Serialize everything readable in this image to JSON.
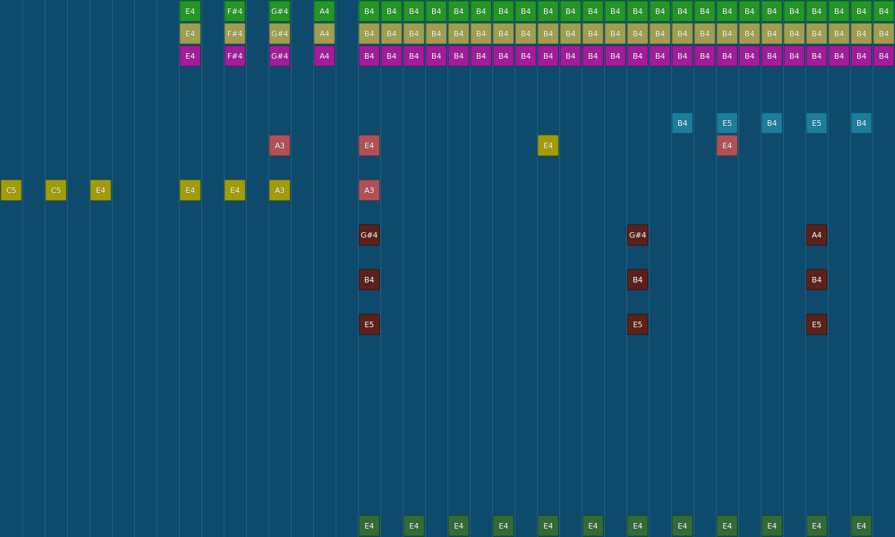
{
  "palette": {
    "green": {
      "bg": "#1f9a1f",
      "border": "#0f6d0f"
    },
    "khaki": {
      "bg": "#a3a34e",
      "border": "#74742d"
    },
    "magenta": {
      "bg": "#a5179e",
      "border": "#730f6e"
    },
    "cyan": {
      "bg": "#177fa0",
      "border": "#0e5b74"
    },
    "rose": {
      "bg": "#b64f55",
      "border": "#87353a"
    },
    "olive": {
      "bg": "#a6a100",
      "border": "#787300"
    },
    "maroon": {
      "bg": "#5a1c14",
      "border": "#3b0f0a"
    },
    "darkgreen": {
      "bg": "#2f6b32",
      "border": "#1c4a1f"
    }
  },
  "notes": [
    {
      "label": "E4",
      "col": 8,
      "row": 0,
      "color": "green"
    },
    {
      "label": "F#4",
      "col": 10,
      "row": 0,
      "color": "green"
    },
    {
      "label": "G#4",
      "col": 12,
      "row": 0,
      "color": "green"
    },
    {
      "label": "A4",
      "col": 14,
      "row": 0,
      "color": "green"
    },
    {
      "label": "B4",
      "col": 16,
      "row": 0,
      "color": "green"
    },
    {
      "label": "B4",
      "col": 17,
      "row": 0,
      "color": "green"
    },
    {
      "label": "B4",
      "col": 18,
      "row": 0,
      "color": "green"
    },
    {
      "label": "B4",
      "col": 19,
      "row": 0,
      "color": "green"
    },
    {
      "label": "B4",
      "col": 20,
      "row": 0,
      "color": "green"
    },
    {
      "label": "B4",
      "col": 21,
      "row": 0,
      "color": "green"
    },
    {
      "label": "B4",
      "col": 22,
      "row": 0,
      "color": "green"
    },
    {
      "label": "B4",
      "col": 23,
      "row": 0,
      "color": "green"
    },
    {
      "label": "B4",
      "col": 24,
      "row": 0,
      "color": "green"
    },
    {
      "label": "B4",
      "col": 25,
      "row": 0,
      "color": "green"
    },
    {
      "label": "B4",
      "col": 26,
      "row": 0,
      "color": "green"
    },
    {
      "label": "B4",
      "col": 27,
      "row": 0,
      "color": "green"
    },
    {
      "label": "B4",
      "col": 28,
      "row": 0,
      "color": "green"
    },
    {
      "label": "B4",
      "col": 29,
      "row": 0,
      "color": "green"
    },
    {
      "label": "B4",
      "col": 30,
      "row": 0,
      "color": "green"
    },
    {
      "label": "B4",
      "col": 31,
      "row": 0,
      "color": "green"
    },
    {
      "label": "B4",
      "col": 32,
      "row": 0,
      "color": "green"
    },
    {
      "label": "B4",
      "col": 33,
      "row": 0,
      "color": "green"
    },
    {
      "label": "B4",
      "col": 34,
      "row": 0,
      "color": "green"
    },
    {
      "label": "B4",
      "col": 35,
      "row": 0,
      "color": "green"
    },
    {
      "label": "B4",
      "col": 36,
      "row": 0,
      "color": "green"
    },
    {
      "label": "B4",
      "col": 37,
      "row": 0,
      "color": "green"
    },
    {
      "label": "B4",
      "col": 38,
      "row": 0,
      "color": "green"
    },
    {
      "label": "B4",
      "col": 39,
      "row": 0,
      "color": "green"
    },
    {
      "label": "E4",
      "col": 8,
      "row": 1,
      "color": "khaki"
    },
    {
      "label": "F#4",
      "col": 10,
      "row": 1,
      "color": "khaki"
    },
    {
      "label": "G#4",
      "col": 12,
      "row": 1,
      "color": "khaki"
    },
    {
      "label": "A4",
      "col": 14,
      "row": 1,
      "color": "khaki"
    },
    {
      "label": "B4",
      "col": 16,
      "row": 1,
      "color": "khaki"
    },
    {
      "label": "B4",
      "col": 17,
      "row": 1,
      "color": "khaki"
    },
    {
      "label": "B4",
      "col": 18,
      "row": 1,
      "color": "khaki"
    },
    {
      "label": "B4",
      "col": 19,
      "row": 1,
      "color": "khaki"
    },
    {
      "label": "B4",
      "col": 20,
      "row": 1,
      "color": "khaki"
    },
    {
      "label": "B4",
      "col": 21,
      "row": 1,
      "color": "khaki"
    },
    {
      "label": "B4",
      "col": 22,
      "row": 1,
      "color": "khaki"
    },
    {
      "label": "B4",
      "col": 23,
      "row": 1,
      "color": "khaki"
    },
    {
      "label": "B4",
      "col": 24,
      "row": 1,
      "color": "khaki"
    },
    {
      "label": "B4",
      "col": 25,
      "row": 1,
      "color": "khaki"
    },
    {
      "label": "B4",
      "col": 26,
      "row": 1,
      "color": "khaki"
    },
    {
      "label": "B4",
      "col": 27,
      "row": 1,
      "color": "khaki"
    },
    {
      "label": "B4",
      "col": 28,
      "row": 1,
      "color": "khaki"
    },
    {
      "label": "B4",
      "col": 29,
      "row": 1,
      "color": "khaki"
    },
    {
      "label": "B4",
      "col": 30,
      "row": 1,
      "color": "khaki"
    },
    {
      "label": "B4",
      "col": 31,
      "row": 1,
      "color": "khaki"
    },
    {
      "label": "B4",
      "col": 32,
      "row": 1,
      "color": "khaki"
    },
    {
      "label": "B4",
      "col": 33,
      "row": 1,
      "color": "khaki"
    },
    {
      "label": "B4",
      "col": 34,
      "row": 1,
      "color": "khaki"
    },
    {
      "label": "B4",
      "col": 35,
      "row": 1,
      "color": "khaki"
    },
    {
      "label": "B4",
      "col": 36,
      "row": 1,
      "color": "khaki"
    },
    {
      "label": "B4",
      "col": 37,
      "row": 1,
      "color": "khaki"
    },
    {
      "label": "B4",
      "col": 38,
      "row": 1,
      "color": "khaki"
    },
    {
      "label": "B4",
      "col": 39,
      "row": 1,
      "color": "khaki"
    },
    {
      "label": "E4",
      "col": 8,
      "row": 2,
      "color": "magenta"
    },
    {
      "label": "F#4",
      "col": 10,
      "row": 2,
      "color": "magenta"
    },
    {
      "label": "G#4",
      "col": 12,
      "row": 2,
      "color": "magenta"
    },
    {
      "label": "A4",
      "col": 14,
      "row": 2,
      "color": "magenta"
    },
    {
      "label": "B4",
      "col": 16,
      "row": 2,
      "color": "magenta"
    },
    {
      "label": "B4",
      "col": 17,
      "row": 2,
      "color": "magenta"
    },
    {
      "label": "B4",
      "col": 18,
      "row": 2,
      "color": "magenta"
    },
    {
      "label": "B4",
      "col": 19,
      "row": 2,
      "color": "magenta"
    },
    {
      "label": "B4",
      "col": 20,
      "row": 2,
      "color": "magenta"
    },
    {
      "label": "B4",
      "col": 21,
      "row": 2,
      "color": "magenta"
    },
    {
      "label": "B4",
      "col": 22,
      "row": 2,
      "color": "magenta"
    },
    {
      "label": "B4",
      "col": 23,
      "row": 2,
      "color": "magenta"
    },
    {
      "label": "B4",
      "col": 24,
      "row": 2,
      "color": "magenta"
    },
    {
      "label": "B4",
      "col": 25,
      "row": 2,
      "color": "magenta"
    },
    {
      "label": "B4",
      "col": 26,
      "row": 2,
      "color": "magenta"
    },
    {
      "label": "B4",
      "col": 27,
      "row": 2,
      "color": "magenta"
    },
    {
      "label": "B4",
      "col": 28,
      "row": 2,
      "color": "magenta"
    },
    {
      "label": "B4",
      "col": 29,
      "row": 2,
      "color": "magenta"
    },
    {
      "label": "B4",
      "col": 30,
      "row": 2,
      "color": "magenta"
    },
    {
      "label": "B4",
      "col": 31,
      "row": 2,
      "color": "magenta"
    },
    {
      "label": "B4",
      "col": 32,
      "row": 2,
      "color": "magenta"
    },
    {
      "label": "B4",
      "col": 33,
      "row": 2,
      "color": "magenta"
    },
    {
      "label": "B4",
      "col": 34,
      "row": 2,
      "color": "magenta"
    },
    {
      "label": "B4",
      "col": 35,
      "row": 2,
      "color": "magenta"
    },
    {
      "label": "B4",
      "col": 36,
      "row": 2,
      "color": "magenta"
    },
    {
      "label": "B4",
      "col": 37,
      "row": 2,
      "color": "magenta"
    },
    {
      "label": "B4",
      "col": 38,
      "row": 2,
      "color": "magenta"
    },
    {
      "label": "B4",
      "col": 39,
      "row": 2,
      "color": "magenta"
    },
    {
      "label": "B4",
      "col": 30,
      "row": 5,
      "color": "cyan"
    },
    {
      "label": "E5",
      "col": 32,
      "row": 5,
      "color": "cyan"
    },
    {
      "label": "B4",
      "col": 34,
      "row": 5,
      "color": "cyan"
    },
    {
      "label": "E5",
      "col": 36,
      "row": 5,
      "color": "cyan"
    },
    {
      "label": "B4",
      "col": 38,
      "row": 5,
      "color": "cyan"
    },
    {
      "label": "A3",
      "col": 12,
      "row": 6,
      "color": "rose"
    },
    {
      "label": "E4",
      "col": 16,
      "row": 6,
      "color": "rose"
    },
    {
      "label": "E4",
      "col": 24,
      "row": 6,
      "color": "olive"
    },
    {
      "label": "E4",
      "col": 32,
      "row": 6,
      "color": "rose"
    },
    {
      "label": "C5",
      "col": 0,
      "row": 8,
      "color": "olive"
    },
    {
      "label": "C5",
      "col": 2,
      "row": 8,
      "color": "olive"
    },
    {
      "label": "E4",
      "col": 4,
      "row": 8,
      "color": "olive"
    },
    {
      "label": "E4",
      "col": 8,
      "row": 8,
      "color": "olive"
    },
    {
      "label": "E4",
      "col": 10,
      "row": 8,
      "color": "olive"
    },
    {
      "label": "A3",
      "col": 12,
      "row": 8,
      "color": "olive"
    },
    {
      "label": "A3",
      "col": 16,
      "row": 8,
      "color": "rose"
    },
    {
      "label": "G#4",
      "col": 16,
      "row": 10,
      "color": "maroon"
    },
    {
      "label": "G#4",
      "col": 28,
      "row": 10,
      "color": "maroon"
    },
    {
      "label": "A4",
      "col": 36,
      "row": 10,
      "color": "maroon"
    },
    {
      "label": "B4",
      "col": 16,
      "row": 12,
      "color": "maroon"
    },
    {
      "label": "B4",
      "col": 28,
      "row": 12,
      "color": "maroon"
    },
    {
      "label": "B4",
      "col": 36,
      "row": 12,
      "color": "maroon"
    },
    {
      "label": "E5",
      "col": 16,
      "row": 14,
      "color": "maroon"
    },
    {
      "label": "E5",
      "col": 28,
      "row": 14,
      "color": "maroon"
    },
    {
      "label": "E5",
      "col": 36,
      "row": 14,
      "color": "maroon"
    },
    {
      "label": "E4",
      "col": 16,
      "row": 23,
      "color": "darkgreen"
    },
    {
      "label": "E4",
      "col": 18,
      "row": 23,
      "color": "darkgreen"
    },
    {
      "label": "E4",
      "col": 20,
      "row": 23,
      "color": "darkgreen"
    },
    {
      "label": "E4",
      "col": 22,
      "row": 23,
      "color": "darkgreen"
    },
    {
      "label": "E4",
      "col": 24,
      "row": 23,
      "color": "darkgreen"
    },
    {
      "label": "E4",
      "col": 26,
      "row": 23,
      "color": "darkgreen"
    },
    {
      "label": "E4",
      "col": 28,
      "row": 23,
      "color": "darkgreen"
    },
    {
      "label": "E4",
      "col": 30,
      "row": 23,
      "color": "darkgreen"
    },
    {
      "label": "E4",
      "col": 32,
      "row": 23,
      "color": "darkgreen"
    },
    {
      "label": "E4",
      "col": 34,
      "row": 23,
      "color": "darkgreen"
    },
    {
      "label": "E4",
      "col": 36,
      "row": 23,
      "color": "darkgreen"
    },
    {
      "label": "E4",
      "col": 38,
      "row": 23,
      "color": "darkgreen"
    }
  ]
}
